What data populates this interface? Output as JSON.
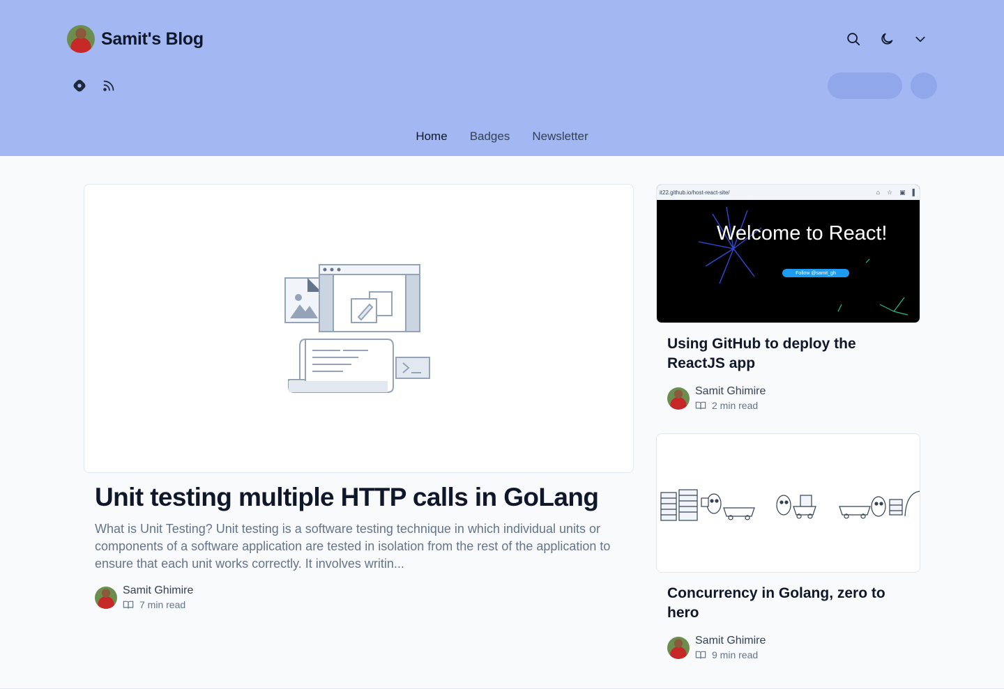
{
  "header": {
    "blog_name": "Samit's Blog",
    "icons": [
      "search-icon",
      "moon-icon",
      "chevron-down-icon"
    ],
    "social_icons": [
      "hashnode-icon",
      "rss-icon"
    ],
    "nav": [
      {
        "label": "Home",
        "active": true
      },
      {
        "label": "Badges",
        "active": false
      },
      {
        "label": "Newsletter",
        "active": false
      }
    ],
    "bg_color": "#a3b7f2"
  },
  "featured": {
    "title": "Unit testing multiple HTTP calls in GoLang",
    "excerpt": "What is Unit Testing? Unit testing is a software testing technique in which individual units or components of a software application are tested in isolation from the rest of the application to ensure that each unit works correctly. It involves writin...",
    "author": "Samit Ghimire",
    "read_time": "7 min read"
  },
  "side_posts": [
    {
      "title": "Using GitHub to deploy the ReactJS app",
      "author": "Samit Ghimire",
      "read_time": "2 min read",
      "cover": {
        "url_text": "it22.github.io/host-react-site/",
        "headline": "Welcome to React!",
        "button": "Follow @samit_gh"
      }
    },
    {
      "title": "Concurrency in Golang, zero to hero",
      "author": "Samit Ghimire",
      "read_time": "9 min read"
    }
  ]
}
